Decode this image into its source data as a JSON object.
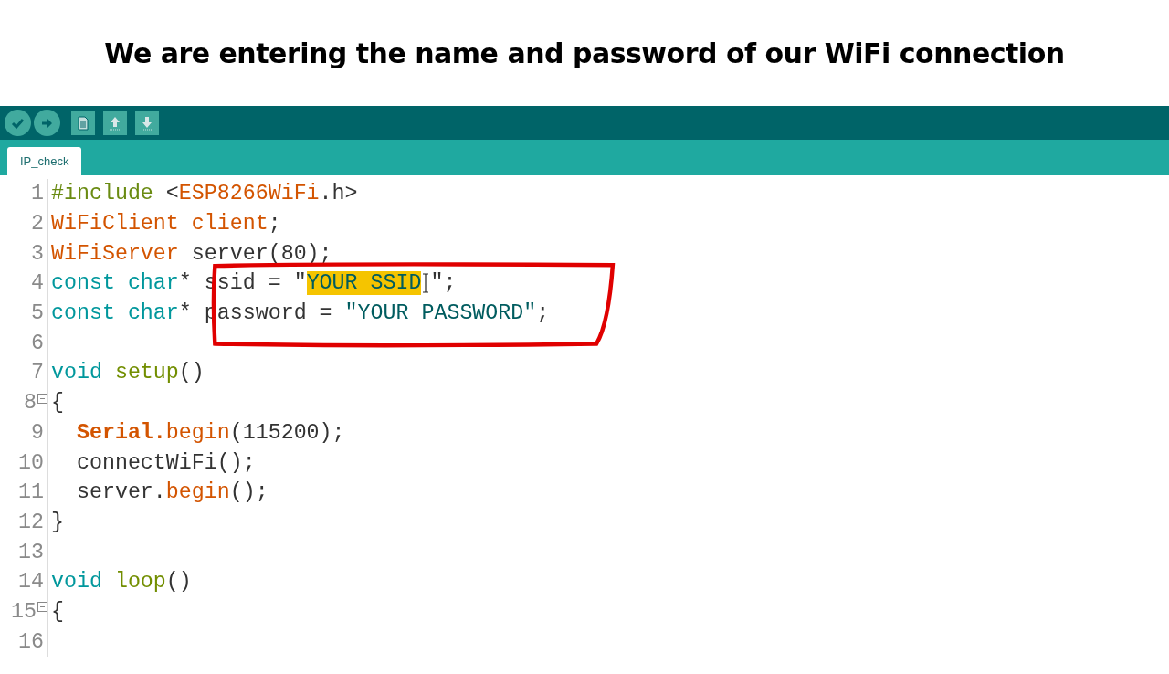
{
  "caption": "We are entering the name and password of our WiFi connection",
  "toolbar": {
    "buttons": [
      {
        "kind": "verify"
      },
      {
        "kind": "upload"
      },
      {
        "kind": "new"
      },
      {
        "kind": "open"
      },
      {
        "kind": "save"
      }
    ]
  },
  "tabs": [
    {
      "label": "IP_check",
      "selected": true
    }
  ],
  "editor": {
    "lines": [
      {
        "number": "1",
        "fold": false,
        "tokens": [
          {
            "kind": "preprocessor",
            "text": "#include "
          },
          {
            "kind": "plain",
            "text": "<"
          },
          {
            "kind": "type",
            "text": "ESP8266WiFi"
          },
          {
            "kind": "plain",
            "text": ".h>"
          }
        ]
      },
      {
        "number": "2",
        "fold": false,
        "tokens": [
          {
            "kind": "type",
            "text": "WiFiClient client"
          },
          {
            "kind": "plain",
            "text": ";"
          }
        ]
      },
      {
        "number": "3",
        "fold": false,
        "tokens": [
          {
            "kind": "type",
            "text": "WiFiServer"
          },
          {
            "kind": "plain",
            "text": " server(80);"
          }
        ]
      },
      {
        "number": "4",
        "fold": false,
        "tokens": [
          {
            "kind": "keyword",
            "text": "const char"
          },
          {
            "kind": "plain",
            "text": "* ssid = \""
          },
          {
            "kind": "selection",
            "text": "YOUR SSID"
          },
          {
            "kind": "cursor"
          },
          {
            "kind": "plain",
            "text": "\";"
          }
        ]
      },
      {
        "number": "5",
        "fold": false,
        "tokens": [
          {
            "kind": "keyword",
            "text": "const char"
          },
          {
            "kind": "plain",
            "text": "* password = "
          },
          {
            "kind": "string",
            "text": "\"YOUR PASSWORD\""
          },
          {
            "kind": "plain",
            "text": ";"
          }
        ]
      },
      {
        "number": "6",
        "fold": false
      },
      {
        "number": "7",
        "fold": false,
        "tokens": [
          {
            "kind": "keyword",
            "text": "void "
          },
          {
            "kind": "function",
            "text": "setup"
          },
          {
            "kind": "plain",
            "text": "()"
          }
        ]
      },
      {
        "number": "8",
        "fold": true,
        "tokens": [
          {
            "kind": "plain",
            "text": "{"
          }
        ]
      },
      {
        "number": "9",
        "fold": false,
        "tokens": [
          {
            "kind": "class",
            "text": "  Serial."
          },
          {
            "kind": "method",
            "text": "begin"
          },
          {
            "kind": "plain",
            "text": "(115200);"
          }
        ]
      },
      {
        "number": "10",
        "fold": false,
        "tokens": [
          {
            "kind": "plain",
            "text": "  connectWiFi();"
          }
        ]
      },
      {
        "number": "11",
        "fold": false,
        "tokens": [
          {
            "kind": "plain",
            "text": "  server."
          },
          {
            "kind": "method",
            "text": "begin"
          },
          {
            "kind": "plain",
            "text": "();"
          }
        ]
      },
      {
        "number": "12",
        "fold": false,
        "tokens": [
          {
            "kind": "plain",
            "text": "}"
          }
        ]
      },
      {
        "number": "13",
        "fold": false
      },
      {
        "number": "14",
        "fold": false,
        "tokens": [
          {
            "kind": "keyword",
            "text": "void "
          },
          {
            "kind": "function",
            "text": "loop"
          },
          {
            "kind": "plain",
            "text": "()"
          }
        ]
      },
      {
        "number": "15",
        "fold": true,
        "tokens": [
          {
            "kind": "plain",
            "text": "{"
          }
        ]
      },
      {
        "number": "16",
        "fold": false
      }
    ]
  }
}
